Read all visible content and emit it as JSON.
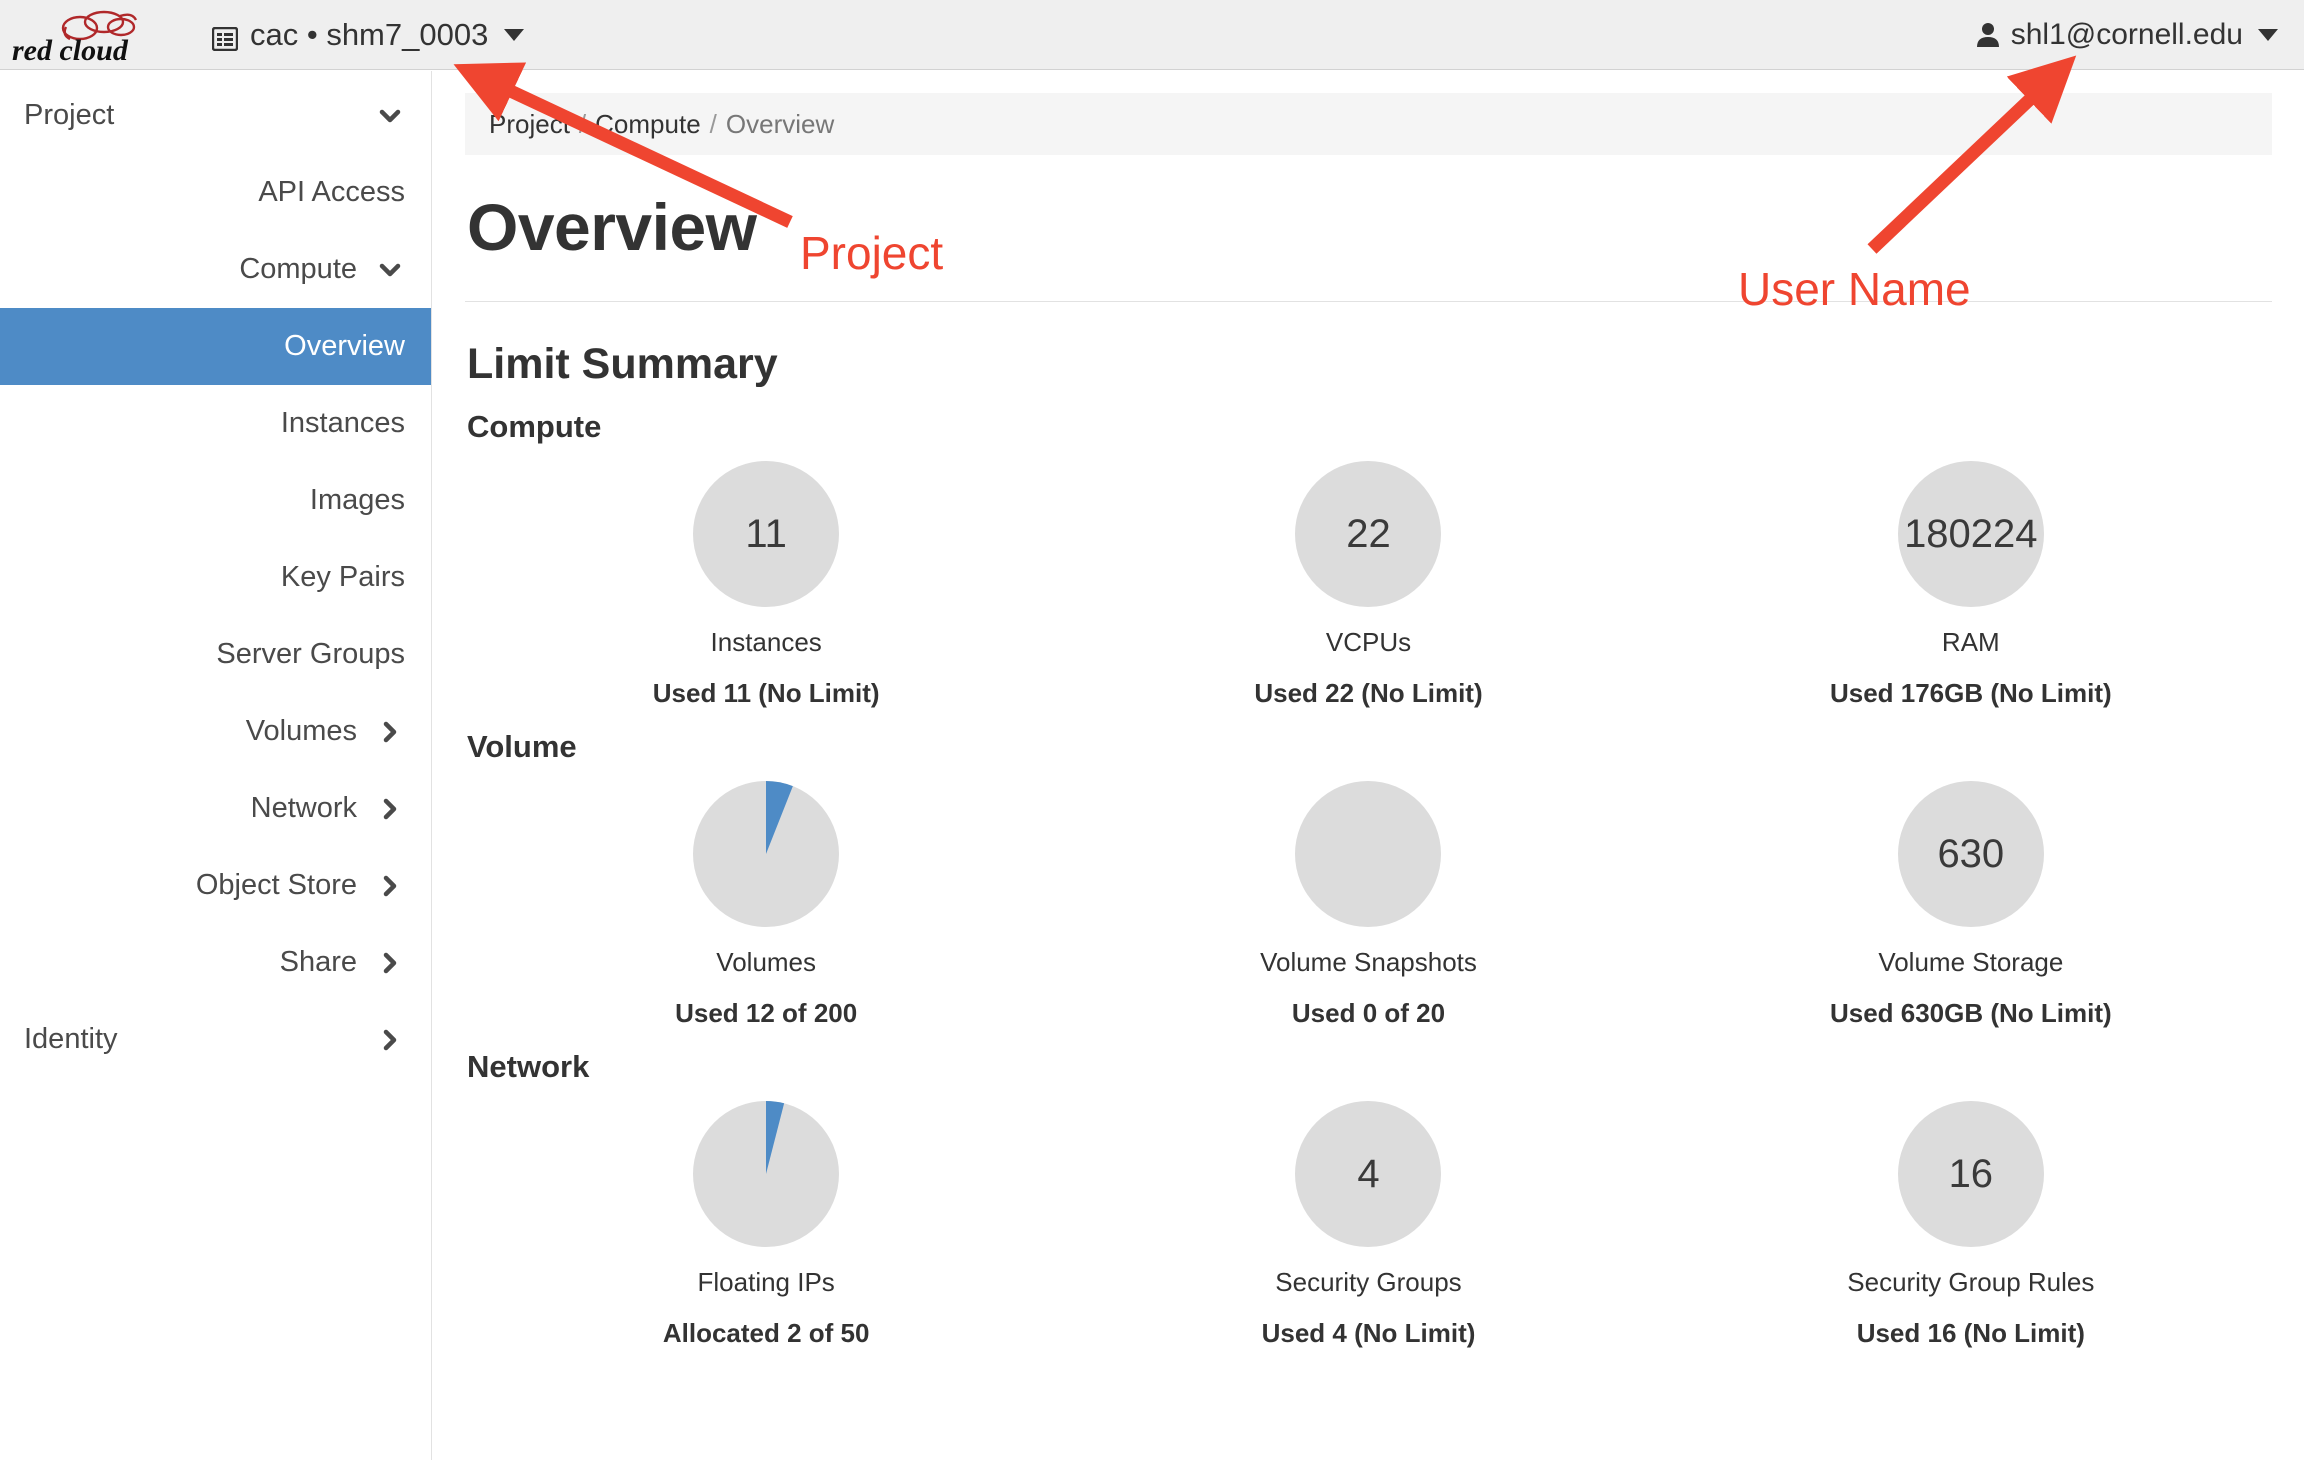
{
  "topbar": {
    "logo_text": "red cloud",
    "project_icon": "project-list-icon",
    "project_switcher_label": "cac • shm7_0003",
    "project_caret_icon": "chevron-down-icon",
    "user_icon": "user-icon",
    "user_label": "shl1@cornell.edu",
    "user_caret_icon": "chevron-down-icon"
  },
  "sidebar": {
    "items": [
      {
        "label": "Project",
        "level": 0,
        "icon": "chevron-down-icon",
        "active": false
      },
      {
        "label": "API Access",
        "level": 1,
        "icon": "",
        "active": false
      },
      {
        "label": "Compute",
        "level": 1,
        "icon": "chevron-down-icon",
        "active": false
      },
      {
        "label": "Overview",
        "level": 2,
        "icon": "",
        "active": true
      },
      {
        "label": "Instances",
        "level": 2,
        "icon": "",
        "active": false
      },
      {
        "label": "Images",
        "level": 2,
        "icon": "",
        "active": false
      },
      {
        "label": "Key Pairs",
        "level": 2,
        "icon": "",
        "active": false
      },
      {
        "label": "Server Groups",
        "level": 2,
        "icon": "",
        "active": false
      },
      {
        "label": "Volumes",
        "level": 1,
        "icon": "chevron-right-icon",
        "active": false
      },
      {
        "label": "Network",
        "level": 1,
        "icon": "chevron-right-icon",
        "active": false
      },
      {
        "label": "Object Store",
        "level": 1,
        "icon": "chevron-right-icon",
        "active": false
      },
      {
        "label": "Share",
        "level": 1,
        "icon": "chevron-right-icon",
        "active": false
      },
      {
        "label": "Identity",
        "level": 0,
        "icon": "chevron-right-icon",
        "active": false
      }
    ]
  },
  "breadcrumb": {
    "items": [
      "Project",
      "Compute",
      "Overview"
    ],
    "separator": "/"
  },
  "page": {
    "title": "Overview",
    "limit_summary_heading": "Limit Summary"
  },
  "chart_data": [
    {
      "type": "pie",
      "title": "Compute",
      "gauges": [
        {
          "name": "Instances",
          "value": 11,
          "display": "11",
          "used_text": "Used 11 (No Limit)",
          "used": 11,
          "limit": null,
          "percent": 0
        },
        {
          "name": "VCPUs",
          "value": 22,
          "display": "22",
          "used_text": "Used 22 (No Limit)",
          "used": 22,
          "limit": null,
          "percent": 0
        },
        {
          "name": "RAM",
          "value": 180224,
          "display": "180224",
          "used_text": "Used 176GB (No Limit)",
          "used": 176,
          "limit": null,
          "percent": 0
        }
      ]
    },
    {
      "type": "pie",
      "title": "Volume",
      "gauges": [
        {
          "name": "Volumes",
          "value": 12,
          "display": "",
          "used_text": "Used 12 of 200",
          "used": 12,
          "limit": 200,
          "percent": 6
        },
        {
          "name": "Volume Snapshots",
          "value": 0,
          "display": "",
          "used_text": "Used 0 of 20",
          "used": 0,
          "limit": 20,
          "percent": 0
        },
        {
          "name": "Volume Storage",
          "value": 630,
          "display": "630",
          "used_text": "Used 630GB (No Limit)",
          "used": 630,
          "limit": null,
          "percent": 0
        }
      ]
    },
    {
      "type": "pie",
      "title": "Network",
      "gauges": [
        {
          "name": "Floating IPs",
          "value": 2,
          "display": "",
          "used_text": "Allocated 2 of 50",
          "used": 2,
          "limit": 50,
          "percent": 4
        },
        {
          "name": "Security Groups",
          "value": 4,
          "display": "4",
          "used_text": "Used 4 (No Limit)",
          "used": 4,
          "limit": null,
          "percent": 0
        },
        {
          "name": "Security Group Rules",
          "value": 16,
          "display": "16",
          "used_text": "Used 16 (No Limit)",
          "used": 16,
          "limit": null,
          "percent": 0
        }
      ]
    }
  ],
  "annotations": [
    {
      "id": "project",
      "label": "Project",
      "color": "#ef4530"
    },
    {
      "id": "username",
      "label": "User Name",
      "color": "#ef4530"
    }
  ],
  "colors": {
    "accent_blue": "#4e8bc6",
    "gauge_gray": "#dcdcdc",
    "annotation_red": "#ef4530",
    "topbar_bg": "#efefef",
    "breadcrumb_bg": "#f5f5f5"
  }
}
